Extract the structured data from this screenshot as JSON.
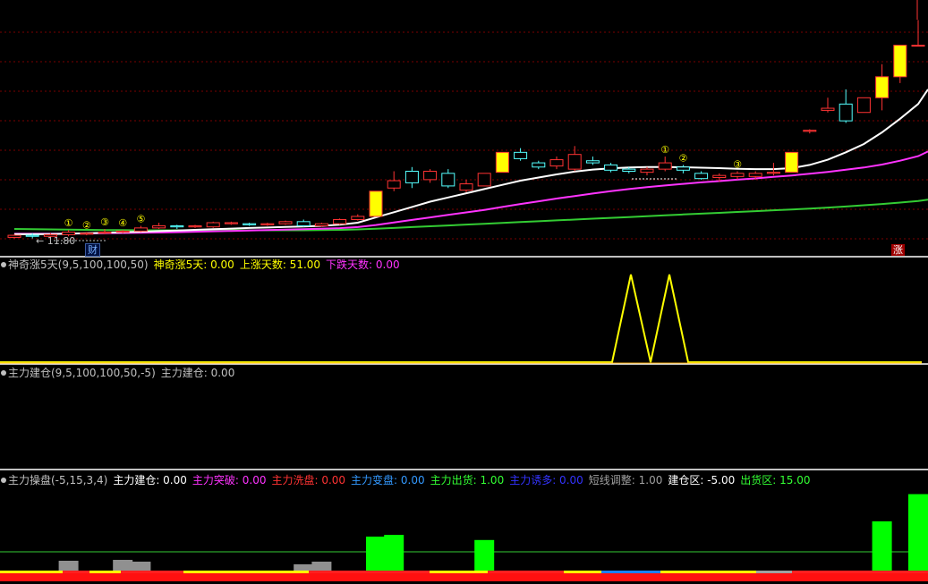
{
  "colors": {
    "background": "#000000",
    "up": "#ff3333",
    "down": "#54ffff",
    "limit_up": "#ffff00",
    "ma_short": "#ffffff",
    "ma_mid": "#ff33ff",
    "ma_long": "#33cc33",
    "grid": "#7a0000",
    "separator": "#ffffff"
  },
  "price_pane": {
    "low_marker": "11.80",
    "cai_badge": "财",
    "zhang_badge": "涨",
    "circled": [
      "①",
      "②",
      "③",
      "④",
      "⑤",
      "①",
      "②",
      "③"
    ]
  },
  "indicator1": {
    "name": "神奇涨5天(9,5,100,100,50)",
    "values": [
      {
        "label": "神奇涨5天: 0.00",
        "color": "#ffff00"
      },
      {
        "label": "上涨天数: 51.00",
        "color": "#ffff00"
      },
      {
        "label": "下跌天数: 0.00",
        "color": "#ff33ff"
      }
    ]
  },
  "indicator2": {
    "name": "主力建仓(9,5,100,100,50,-5)",
    "values": [
      {
        "label": "主力建仓: 0.00",
        "color": "#c0c0c0"
      }
    ]
  },
  "indicator3": {
    "name": "主力操盘(-5,15,3,4)",
    "values": [
      {
        "label": "主力建仓: 0.00",
        "color": "#ffffff"
      },
      {
        "label": "主力突破: 0.00",
        "color": "#ff33ff"
      },
      {
        "label": "主力洗盘: 0.00",
        "color": "#ff3333"
      },
      {
        "label": "主力变盘: 0.00",
        "color": "#3399ff"
      },
      {
        "label": "主力出货: 1.00",
        "color": "#33ff33"
      },
      {
        "label": "主力诱多: 0.00",
        "color": "#3333ff"
      },
      {
        "label": "短线调整: 1.00",
        "color": "#a0a0a0"
      },
      {
        "label": "建仓区: -5.00",
        "color": "#ffffff"
      },
      {
        "label": "出货区: 15.00",
        "color": "#33ff33"
      }
    ]
  },
  "chart_data": [
    {
      "type": "candlestick",
      "candles": [
        [
          11.85,
          11.95,
          11.8,
          12.0
        ],
        [
          11.95,
          11.9,
          11.8,
          12.05
        ],
        [
          11.9,
          11.98,
          11.85,
          12.05
        ],
        [
          11.98,
          12.1,
          11.9,
          12.2
        ],
        [
          12.0,
          12.05,
          11.95,
          12.1
        ],
        [
          12.05,
          12.1,
          12.0,
          12.25
        ],
        [
          12.1,
          12.15,
          12.05,
          12.2
        ],
        [
          12.15,
          12.3,
          12.1,
          12.4
        ],
        [
          12.3,
          12.4,
          12.25,
          12.55
        ],
        [
          12.4,
          12.35,
          12.25,
          12.45
        ],
        [
          12.35,
          12.4,
          12.3,
          12.45
        ],
        [
          12.35,
          12.55,
          12.3,
          12.6
        ],
        [
          12.5,
          12.55,
          12.45,
          12.6
        ],
        [
          12.5,
          12.45,
          12.4,
          12.55
        ],
        [
          12.45,
          12.5,
          12.4,
          12.55
        ],
        [
          12.5,
          12.6,
          12.45,
          12.65
        ],
        [
          12.6,
          12.4,
          12.35,
          12.7
        ],
        [
          12.4,
          12.5,
          12.35,
          12.55
        ],
        [
          12.5,
          12.7,
          12.45,
          12.75
        ],
        [
          12.7,
          12.85,
          12.65,
          12.95
        ],
        [
          12.85,
          14.05,
          12.85,
          14.05
        ],
        [
          14.2,
          14.55,
          14.05,
          15.0
        ],
        [
          15.0,
          14.45,
          14.2,
          15.2
        ],
        [
          14.6,
          15.0,
          14.45,
          15.1
        ],
        [
          14.9,
          14.3,
          14.2,
          15.1
        ],
        [
          14.1,
          14.4,
          14.0,
          14.6
        ],
        [
          14.3,
          14.9,
          14.3,
          14.9
        ],
        [
          14.95,
          15.9,
          14.95,
          15.9
        ],
        [
          15.9,
          15.6,
          15.5,
          16.1
        ],
        [
          15.4,
          15.2,
          15.1,
          15.5
        ],
        [
          15.25,
          15.55,
          15.1,
          15.7
        ],
        [
          15.1,
          15.8,
          15.0,
          16.2
        ],
        [
          15.5,
          15.4,
          15.3,
          15.7
        ],
        [
          15.3,
          15.05,
          14.95,
          15.4
        ],
        [
          15.1,
          15.0,
          14.9,
          15.2
        ],
        [
          14.95,
          15.1,
          14.8,
          15.2
        ],
        [
          15.1,
          15.4,
          15.0,
          15.7
        ],
        [
          15.2,
          15.05,
          14.9,
          15.3
        ],
        [
          14.9,
          14.65,
          14.6,
          15.0
        ],
        [
          14.7,
          14.8,
          14.5,
          14.9
        ],
        [
          14.75,
          14.9,
          14.6,
          15.0
        ],
        [
          14.75,
          14.9,
          14.6,
          15.0
        ],
        [
          14.9,
          14.95,
          14.8,
          15.4
        ],
        [
          14.95,
          15.9,
          14.95,
          15.9
        ],
        [
          16.9,
          16.95,
          16.8,
          17.0
        ],
        [
          17.9,
          18.0,
          17.8,
          18.5
        ],
        [
          18.2,
          17.4,
          17.3,
          18.9
        ],
        [
          17.8,
          18.5,
          17.8,
          18.5
        ],
        [
          18.5,
          19.5,
          17.9,
          20.1
        ],
        [
          19.5,
          21.0,
          19.2,
          21.0
        ],
        [
          21.0,
          21.0,
          21.0,
          22.2
        ]
      ],
      "ma_short": [
        12.0,
        12.0,
        12.01,
        12.03,
        12.05,
        12.07,
        12.1,
        12.12,
        12.15,
        12.18,
        12.21,
        12.24,
        12.27,
        12.3,
        12.32,
        12.35,
        12.37,
        12.4,
        12.45,
        12.55,
        12.8,
        13.05,
        13.3,
        13.55,
        13.75,
        13.95,
        14.15,
        14.35,
        14.55,
        14.7,
        14.85,
        14.98,
        15.08,
        15.14,
        15.18,
        15.2,
        15.2,
        15.19,
        15.17,
        15.15,
        15.12,
        15.1,
        15.1,
        15.15,
        15.3,
        15.55,
        15.9,
        16.3,
        16.85,
        17.5,
        18.2
      ],
      "ma_mid": [
        12.02,
        12.02,
        12.02,
        12.03,
        12.04,
        12.05,
        12.06,
        12.07,
        12.08,
        12.1,
        12.12,
        12.14,
        12.16,
        12.18,
        12.2,
        12.22,
        12.24,
        12.26,
        12.29,
        12.34,
        12.44,
        12.56,
        12.68,
        12.8,
        12.92,
        13.04,
        13.16,
        13.3,
        13.44,
        13.57,
        13.7,
        13.82,
        13.94,
        14.05,
        14.15,
        14.24,
        14.32,
        14.4,
        14.47,
        14.53,
        14.6,
        14.66,
        14.73,
        14.8,
        14.88,
        14.97,
        15.07,
        15.18,
        15.32,
        15.5,
        15.72
      ],
      "ma_long": [
        12.25,
        12.24,
        12.23,
        12.22,
        12.21,
        12.2,
        12.2,
        12.19,
        12.19,
        12.19,
        12.19,
        12.19,
        12.19,
        12.19,
        12.19,
        12.19,
        12.19,
        12.2,
        12.21,
        12.23,
        12.26,
        12.3,
        12.34,
        12.38,
        12.42,
        12.46,
        12.5,
        12.54,
        12.58,
        12.62,
        12.66,
        12.7,
        12.74,
        12.78,
        12.82,
        12.86,
        12.9,
        12.94,
        12.98,
        13.02,
        13.06,
        13.1,
        13.14,
        13.18,
        13.22,
        13.27,
        13.32,
        13.38,
        13.44,
        13.51,
        13.58
      ],
      "ylim": [
        11.4,
        22.9
      ]
    },
    {
      "type": "line",
      "x": [
        0,
        30,
        31,
        32,
        33,
        34,
        35,
        50
      ],
      "values": [
        0,
        0,
        5,
        0,
        5,
        0,
        0,
        0
      ],
      "ylim": [
        0,
        5
      ]
    },
    {
      "type": "line",
      "values": [
        0
      ],
      "ylim": [
        -1,
        1
      ]
    },
    {
      "type": "bar",
      "series": [
        {
          "values": [
            0,
            0,
            0,
            0,
            0,
            0,
            0,
            0,
            0,
            0,
            0,
            0,
            0,
            0,
            0,
            0,
            0,
            0,
            0,
            0,
            4.0,
            4.2,
            0,
            0,
            0,
            0,
            3.6,
            0,
            0,
            0,
            0,
            0,
            0,
            0,
            0,
            0,
            0,
            0,
            0,
            0,
            0,
            0,
            0,
            0,
            0,
            0,
            0,
            0,
            5.8,
            0,
            9.0
          ]
        },
        {
          "values": [
            0,
            0,
            0,
            1.1,
            0,
            0,
            1.2,
            1.0,
            0,
            0,
            0,
            0,
            0,
            0,
            0,
            0,
            0.7,
            1.0,
            0,
            0,
            0,
            0,
            0,
            0,
            0,
            0,
            0,
            0,
            0,
            0,
            0,
            0,
            0,
            0,
            0,
            0,
            0,
            0,
            0,
            0,
            0,
            0,
            0,
            0,
            0,
            0,
            0,
            0,
            0,
            0,
            0
          ]
        }
      ],
      "ylim": [
        -5,
        15
      ]
    }
  ]
}
